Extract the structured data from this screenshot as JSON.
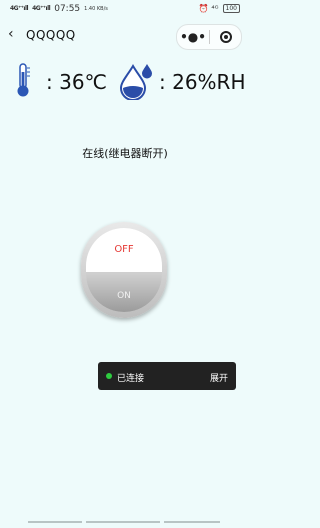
{
  "status_bar": {
    "network1": "4G⁺⁺ıll",
    "network2": "4G⁺⁺ıll",
    "time": "07:55",
    "speed": "1.40 KB/s",
    "right_icons": "⏰ ⁴ᴳ",
    "battery": "100"
  },
  "nav": {
    "back_icon": "‹",
    "title": "QQQQQ",
    "more": "•●•"
  },
  "readings": {
    "temperature": ": 36℃",
    "humidity": ": 26%RH"
  },
  "device_status": "在线(继电器断开)",
  "switch": {
    "off_label": "OFF",
    "on_label": "ON"
  },
  "toast": {
    "text": "已连接",
    "action": "展开"
  },
  "colors": {
    "background": "#eefbfb",
    "thermometer": "#2b57b5",
    "drop": "#2b4da8",
    "off_text": "#e53935",
    "toast_bg": "#222222",
    "connected_dot": "#2ecc40"
  }
}
